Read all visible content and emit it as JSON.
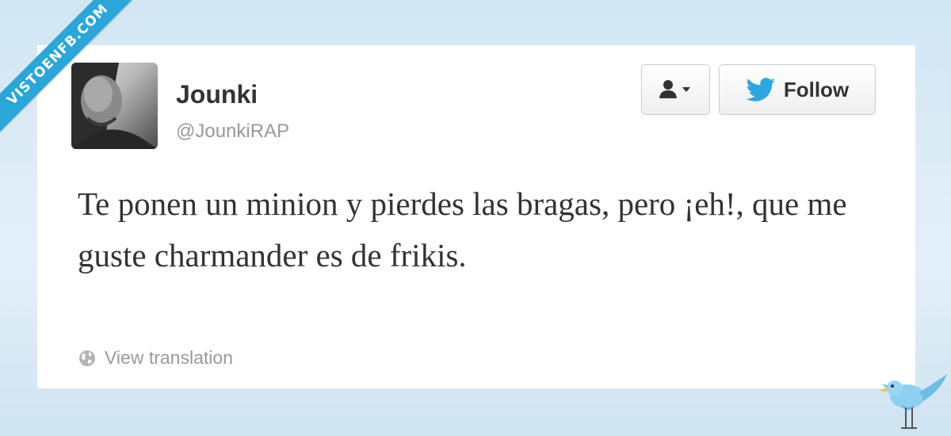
{
  "watermark": {
    "text": "VISTOENFB.COM"
  },
  "tweet": {
    "display_name": "Jounki",
    "handle": "@JounkiRAP",
    "text": "Te ponen un minion y pierdes las bragas, pero ¡eh!, que me guste charmander es de frikis.",
    "translate_label": "View translation"
  },
  "actions": {
    "user_menu_icon": "user-dropdown-icon",
    "follow_label": "Follow",
    "follow_icon": "twitter-bird-icon"
  },
  "colors": {
    "background": "#d2e6f4",
    "watermark_ribbon": "#2aa6d9",
    "twitter_blue": "#2ea7e0",
    "name_text": "#333333",
    "secondary_text": "#999999"
  }
}
